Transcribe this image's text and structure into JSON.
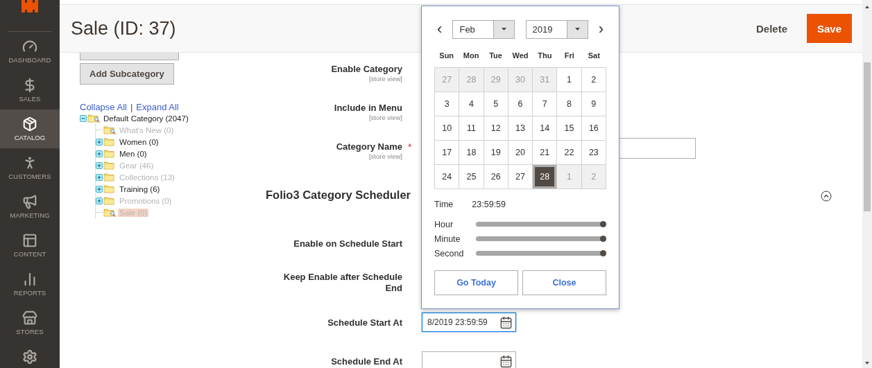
{
  "sidebar": {
    "items": [
      {
        "label": "DASHBOARD",
        "selected": false
      },
      {
        "label": "SALES",
        "selected": false
      },
      {
        "label": "CATALOG",
        "selected": true
      },
      {
        "label": "CUSTOMERS",
        "selected": false
      },
      {
        "label": "MARKETING",
        "selected": false
      },
      {
        "label": "CONTENT",
        "selected": false
      },
      {
        "label": "REPORTS",
        "selected": false
      },
      {
        "label": "STORES",
        "selected": false
      }
    ]
  },
  "header": {
    "title": "Sale (ID: 37)",
    "delete": "Delete",
    "save": "Save"
  },
  "tree": {
    "add_subcategory": "Add Subcategory",
    "collapse_all": "Collapse All",
    "separator": "|",
    "expand_all": "Expand All",
    "root": {
      "label": "Default Category (2047)",
      "kind": "root",
      "expanded": true,
      "active": true,
      "selected": false,
      "children": [
        {
          "label": "What's New (0)",
          "kind": "leaf",
          "active": false,
          "selected": false
        },
        {
          "label": "Women (0)",
          "kind": "branch",
          "expanded": false,
          "active": true,
          "selected": false
        },
        {
          "label": "Men (0)",
          "kind": "branch",
          "expanded": false,
          "active": true,
          "selected": false
        },
        {
          "label": "Gear (46)",
          "kind": "branch",
          "expanded": false,
          "active": false,
          "selected": false
        },
        {
          "label": "Collections (13)",
          "kind": "branch",
          "expanded": false,
          "active": false,
          "selected": false
        },
        {
          "label": "Training (6)",
          "kind": "branch",
          "expanded": false,
          "active": true,
          "selected": false
        },
        {
          "label": "Promotions (0)",
          "kind": "branch",
          "expanded": false,
          "active": false,
          "selected": false
        },
        {
          "label": "Sale (0)",
          "kind": "leaf",
          "active": false,
          "selected": true
        }
      ]
    }
  },
  "required_mark": "*",
  "general_fields": [
    {
      "label": "Enable Category",
      "scope": "[store view]",
      "required": false,
      "kind": "hidden"
    },
    {
      "label": "Include in Menu",
      "scope": "[store view]",
      "required": false,
      "kind": "hidden"
    },
    {
      "label": "Category Name",
      "scope": "[store view]",
      "required": true,
      "kind": "text"
    }
  ],
  "scheduler": {
    "title": "Folio3 Category Scheduler",
    "expanded": true,
    "fields": [
      {
        "label": "Enable on Schedule Start",
        "kind": "hidden"
      },
      {
        "label": "Keep Enable after Schedule End",
        "kind": "hidden"
      },
      {
        "label": "Schedule Start At",
        "kind": "date",
        "value": "8/2019 23:59:59",
        "focused": true
      },
      {
        "label": "Schedule End At",
        "kind": "date",
        "focused": false
      }
    ]
  },
  "calendar": {
    "prev": "‹",
    "next": "›",
    "month": "Feb",
    "year": "2019",
    "weekdays": [
      "Sun",
      "Mon",
      "Tue",
      "Wed",
      "Thu",
      "Fri",
      "Sat"
    ],
    "weeks": [
      [
        {
          "day": "27",
          "outside": true,
          "selected": false
        },
        {
          "day": "28",
          "outside": true,
          "selected": false
        },
        {
          "day": "29",
          "outside": true,
          "selected": false
        },
        {
          "day": "30",
          "outside": true,
          "selected": false
        },
        {
          "day": "31",
          "outside": true,
          "selected": false
        },
        {
          "day": "1",
          "outside": false,
          "selected": false
        },
        {
          "day": "2",
          "outside": false,
          "selected": false
        }
      ],
      [
        {
          "day": "3",
          "outside": false,
          "selected": false
        },
        {
          "day": "4",
          "outside": false,
          "selected": false
        },
        {
          "day": "5",
          "outside": false,
          "selected": false
        },
        {
          "day": "6",
          "outside": false,
          "selected": false
        },
        {
          "day": "7",
          "outside": false,
          "selected": false
        },
        {
          "day": "8",
          "outside": false,
          "selected": false
        },
        {
          "day": "9",
          "outside": false,
          "selected": false
        }
      ],
      [
        {
          "day": "10",
          "outside": false,
          "selected": false
        },
        {
          "day": "11",
          "outside": false,
          "selected": false
        },
        {
          "day": "12",
          "outside": false,
          "selected": false
        },
        {
          "day": "13",
          "outside": false,
          "selected": false
        },
        {
          "day": "14",
          "outside": false,
          "selected": false
        },
        {
          "day": "15",
          "outside": false,
          "selected": false
        },
        {
          "day": "16",
          "outside": false,
          "selected": false
        }
      ],
      [
        {
          "day": "17",
          "outside": false,
          "selected": false
        },
        {
          "day": "18",
          "outside": false,
          "selected": false
        },
        {
          "day": "19",
          "outside": false,
          "selected": false
        },
        {
          "day": "20",
          "outside": false,
          "selected": false
        },
        {
          "day": "21",
          "outside": false,
          "selected": false
        },
        {
          "day": "22",
          "outside": false,
          "selected": false
        },
        {
          "day": "23",
          "outside": false,
          "selected": false
        }
      ],
      [
        {
          "day": "24",
          "outside": false,
          "selected": false
        },
        {
          "day": "25",
          "outside": false,
          "selected": false
        },
        {
          "day": "26",
          "outside": false,
          "selected": false
        },
        {
          "day": "27",
          "outside": false,
          "selected": false
        },
        {
          "day": "28",
          "outside": false,
          "selected": true
        },
        {
          "day": "1",
          "outside": true,
          "selected": false
        },
        {
          "day": "2",
          "outside": true,
          "selected": false
        }
      ]
    ],
    "time_label": "Time",
    "time_value": "23:59:59",
    "sliders": [
      {
        "label": "Hour",
        "level": 1
      },
      {
        "label": "Minute",
        "level": 1
      },
      {
        "label": "Second",
        "level": 1
      }
    ],
    "go_today": "Go Today",
    "close": "Close"
  }
}
